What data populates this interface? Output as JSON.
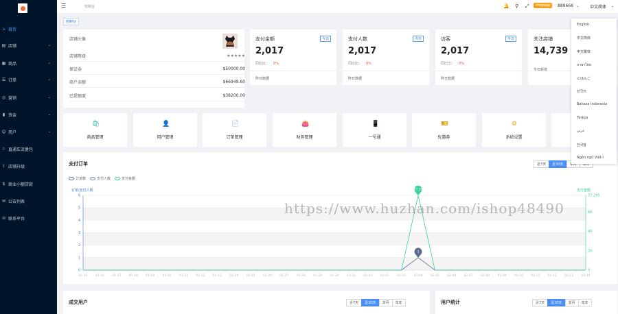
{
  "sidebar": {
    "items": [
      {
        "label": "首页",
        "icon": "home-icon",
        "active": true,
        "chevron": false
      },
      {
        "label": "店铺",
        "icon": "shop-icon",
        "active": false,
        "chevron": true
      },
      {
        "label": "商品",
        "icon": "goods-icon",
        "active": false,
        "chevron": true
      },
      {
        "label": "订单",
        "icon": "order-icon",
        "active": false,
        "chevron": true
      },
      {
        "label": "营销",
        "icon": "marketing-icon",
        "active": false,
        "chevron": true
      },
      {
        "label": "资金",
        "icon": "finance-icon",
        "active": false,
        "chevron": true
      },
      {
        "label": "用户",
        "icon": "user-icon",
        "active": false,
        "chevron": true
      },
      {
        "label": "直通车流量包",
        "icon": "traffic-icon",
        "active": false,
        "chevron": false
      },
      {
        "label": "店铺升级",
        "icon": "upgrade-icon",
        "active": false,
        "chevron": false
      },
      {
        "label": "商业小额贷款",
        "icon": "loan-icon",
        "active": false,
        "chevron": false
      },
      {
        "label": "公告列表",
        "icon": "notice-icon",
        "active": false,
        "chevron": false
      },
      {
        "label": "联系平台",
        "icon": "contact-icon",
        "active": false,
        "chevron": false
      }
    ]
  },
  "header": {
    "breadcrumb": "控制台",
    "shop_tag": "shopapp",
    "user_id": "889666",
    "language": "中文简体"
  },
  "tabs": {
    "active": "控制台"
  },
  "shop": {
    "rows": [
      {
        "label": "店铺头像",
        "value": ""
      },
      {
        "label": "店铺等级",
        "value": "★★★★★"
      },
      {
        "label": "保证金",
        "value": "$50000.00"
      },
      {
        "label": "商户余额",
        "value": "$66949.60"
      },
      {
        "label": "已提额度",
        "value": "$38200.00"
      }
    ]
  },
  "stats": [
    {
      "title": "支付金额",
      "badge": "今日",
      "value": "2,017",
      "sub_label": "同比比：",
      "sub_value": "0%",
      "foot": "昨日数据"
    },
    {
      "title": "支付人数",
      "badge": "今日",
      "value": "2,017",
      "sub_label": "同比比：",
      "sub_value": "0%",
      "foot": "昨日数据"
    },
    {
      "title": "访客",
      "badge": "今日",
      "value": "2,017",
      "sub_label": "同比比：",
      "sub_value": "0%",
      "foot": "昨日数据"
    },
    {
      "title": "关注店铺",
      "badge": "",
      "value": "14,739",
      "sub_label": "",
      "sub_value": "",
      "foot": "今日新增"
    }
  ],
  "quick_links": [
    {
      "label": "商品管理",
      "icon": "bag-icon",
      "color": "#2bb5a2"
    },
    {
      "label": "用户管理",
      "icon": "person-icon",
      "color": "#4a8ff7"
    },
    {
      "label": "订单管理",
      "icon": "document-icon",
      "color": "#f07b3f"
    },
    {
      "label": "财务管理",
      "icon": "wallet-icon",
      "color": "#9c6ade"
    },
    {
      "label": "一号通",
      "icon": "phone-icon",
      "color": "#f3b12a"
    },
    {
      "label": "优惠券",
      "icon": "coupon-icon",
      "color": "#2bb5a2"
    },
    {
      "label": "系统设置",
      "icon": "gear-icon",
      "color": "#f3a21b"
    },
    {
      "label": "",
      "icon": "more-icon",
      "color": "#999999"
    }
  ],
  "range_buttons": [
    "近7天",
    "近30天",
    "本月",
    "本年"
  ],
  "bottom": {
    "left_title": "成交用户",
    "right_title": "用户统计"
  },
  "language_menu": [
    "English",
    "中文简体",
    "中文繁体",
    "ภาษาไทย",
    "にほんご",
    "한국어",
    "Bahasa Indonesia",
    "Türkçe",
    "عربي",
    "한국말",
    "Ngôn ngữ Việt-I"
  ],
  "watermark": "https://www.huzhan.com/ishop48490",
  "chart_data": {
    "type": "line",
    "title": "支付订单",
    "legend": [
      "订单数",
      "支付人数",
      "支付金额"
    ],
    "y_left_label": "订单/支付人数",
    "y_right_label": "支付金额",
    "categories": [
      "01-15",
      "01-16",
      "01-17",
      "01-18",
      "01-19",
      "01-20",
      "01-21",
      "01-22",
      "01-23",
      "01-24",
      "01-25",
      "01-26",
      "01-27",
      "01-28",
      "01-29",
      "01-30",
      "01-31",
      "02-01",
      "02-02",
      "02-03",
      "02-04",
      "02-05",
      "02-06",
      "02-07",
      "02-08",
      "02-09",
      "02-10",
      "02-11",
      "02-12",
      "02-13",
      "02-14"
    ],
    "ylim_left": [
      0,
      6
    ],
    "ylim_right": [
      0,
      77.295
    ],
    "y_left_ticks": [
      "0",
      "1",
      "2",
      "3",
      "4",
      "5",
      "6"
    ],
    "y_right_ticks": [
      "0",
      "20",
      "40",
      "60",
      "77.295"
    ],
    "peak_index": 20,
    "series": [
      {
        "name": "订单数",
        "axis": "left",
        "color": "#5a6b8c",
        "values": [
          0,
          0,
          0,
          0,
          0,
          0,
          0,
          0,
          0,
          0,
          0,
          0,
          0,
          0,
          0,
          0,
          0,
          0,
          0,
          0,
          1,
          0,
          0,
          0,
          0,
          0,
          0,
          0,
          0,
          0,
          0
        ]
      },
      {
        "name": "支付人数",
        "axis": "left",
        "color": "#7a8aa8",
        "values": [
          0,
          0,
          0,
          0,
          0,
          0,
          0,
          0,
          0,
          0,
          0,
          0,
          0,
          0,
          0,
          0,
          0,
          0,
          0,
          0,
          1,
          0,
          0,
          0,
          0,
          0,
          0,
          0,
          0,
          0,
          0
        ]
      },
      {
        "name": "支付金额",
        "axis": "right",
        "color": "#3ccfa0",
        "values": [
          0,
          0,
          0,
          0,
          0,
          0,
          0,
          0,
          0,
          0,
          0,
          0,
          0,
          0,
          0,
          0,
          0,
          0,
          0,
          0,
          77.29,
          0,
          0,
          0,
          0,
          0,
          0,
          0,
          0,
          0,
          0
        ]
      }
    ],
    "peak_labels": {
      "count": "1",
      "amount": "77.29"
    }
  }
}
